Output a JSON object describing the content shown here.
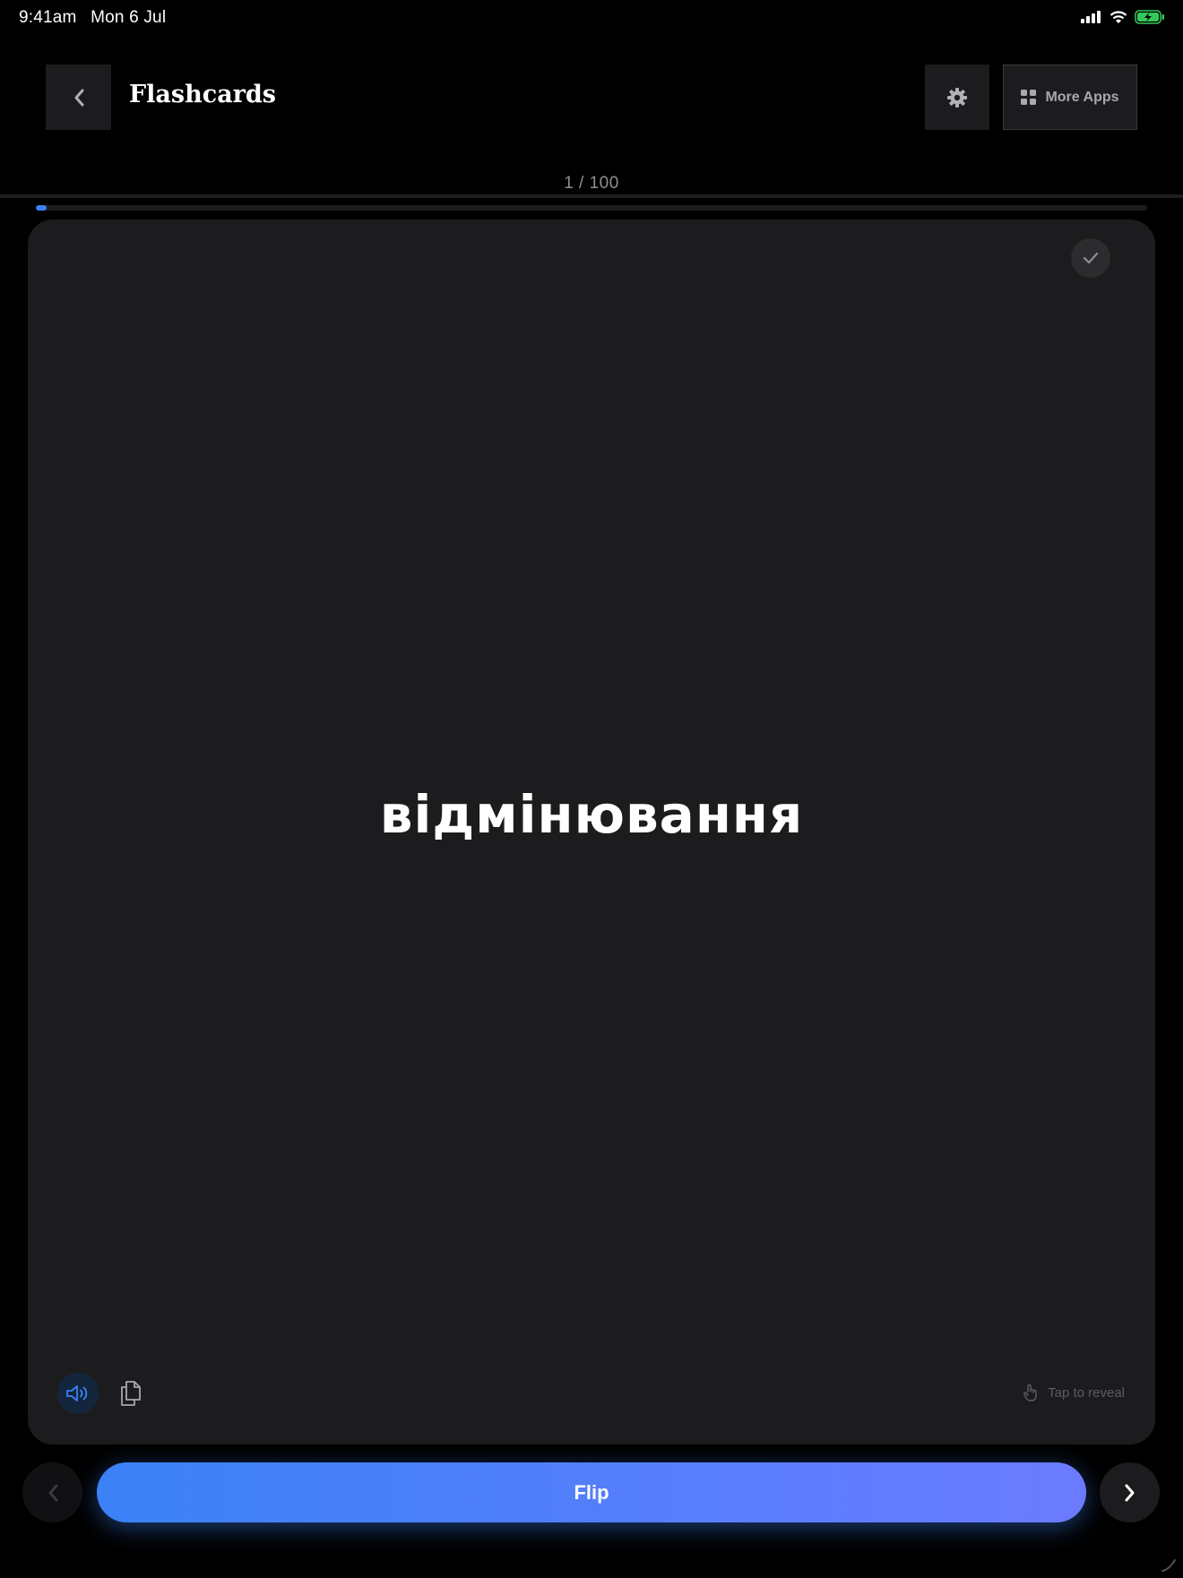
{
  "status_bar": {
    "time": "9:41am",
    "date": "Mon 6 Jul",
    "icons": [
      "signal-icon",
      "wifi-icon",
      "battery-charging-icon"
    ]
  },
  "header": {
    "title": "Flashcards",
    "back_icon": "chevron-left-icon",
    "settings_icon": "gear-icon",
    "more_apps_label": "More Apps",
    "more_apps_icon": "grid-icon"
  },
  "progress": {
    "counter": "1 / 100",
    "current": 1,
    "total": 100,
    "fraction": 0.01
  },
  "card": {
    "word": "відмінювання",
    "check_icon": "check-icon",
    "speaker_icon": "speaker-icon",
    "copy_icon": "copy-icon",
    "hint_icon": "tap-hand-icon",
    "hint": "Tap to reveal"
  },
  "controls": {
    "prev_icon": "chevron-left-icon",
    "flip_label": "Flip",
    "next_icon": "chevron-right-icon"
  },
  "colors": {
    "accent": "#3b82f6",
    "accent_end": "#6b7bff",
    "battery": "#34c759",
    "card_bg": "#1c1c1e",
    "background": "#000000"
  }
}
